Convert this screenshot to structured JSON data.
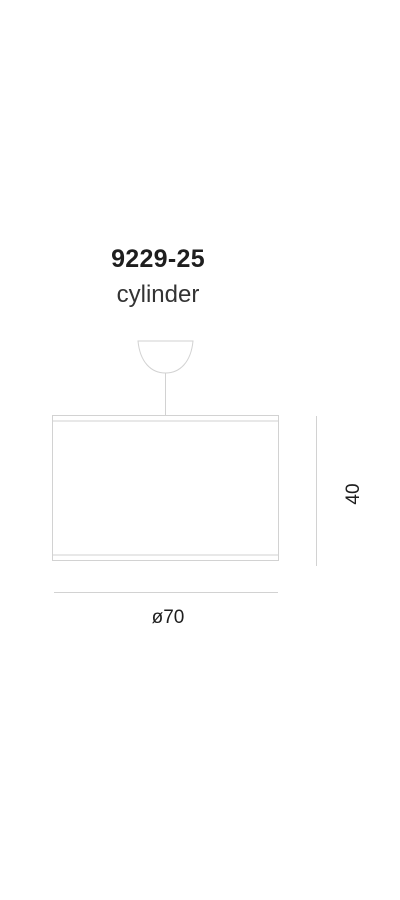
{
  "product": {
    "code": "9229-25",
    "shape": "cylinder"
  },
  "dimensions": {
    "width_label": "ø70",
    "height_label": "40"
  },
  "colors": {
    "text": "#1e1e1e",
    "line": "#d2d2d2"
  }
}
